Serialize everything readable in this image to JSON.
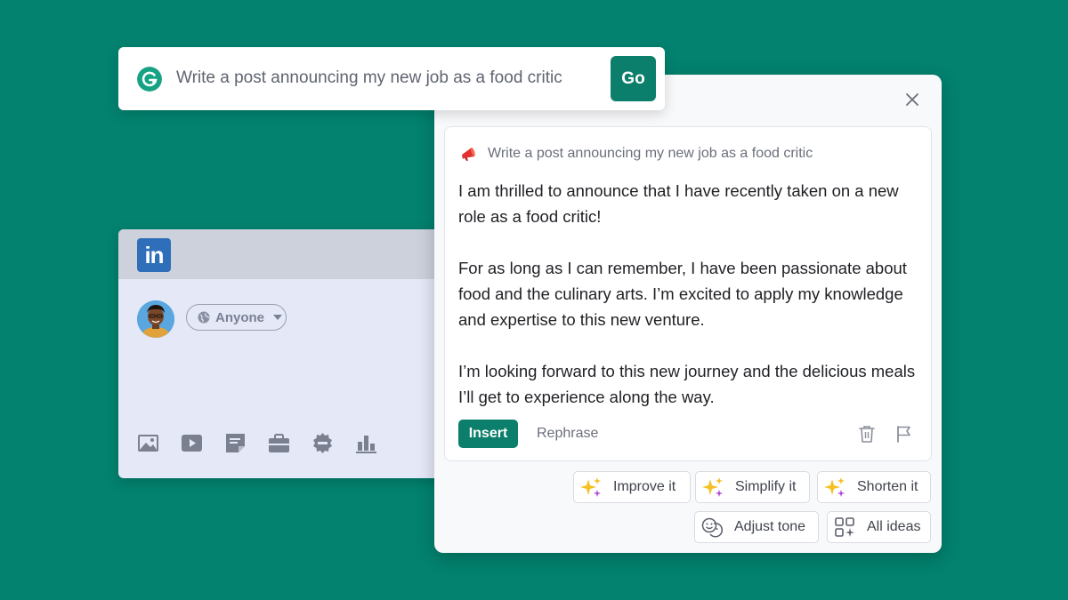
{
  "prompt_bar": {
    "text": "Write a post announcing my new job as a food critic",
    "go_label": "Go"
  },
  "linkedin": {
    "logo": "in",
    "audience": "Anyone",
    "tools": [
      "image-icon",
      "video-icon",
      "document-icon",
      "briefcase-icon",
      "badge-icon",
      "poll-icon"
    ]
  },
  "panel": {
    "prompt_echo": "Write a post announcing my new job as a food critic",
    "paragraphs": [
      "I am thrilled to announce that I have recently taken on a new role as a food critic!",
      "For as long as I can remember, I have been passionate about food and the culinary arts. I’m excited to apply my knowledge and expertise to this new venture.",
      "I’m looking forward to this new journey and the delicious meals I’ll get to experience along the way."
    ],
    "insert_label": "Insert",
    "rephrase_label": "Rephrase",
    "chips": {
      "improve": "Improve it",
      "simplify": "Simplify it",
      "shorten": "Shorten it",
      "adjust_tone": "Adjust tone",
      "all_ideas": "All ideas"
    }
  },
  "colors": {
    "background": "#03826f",
    "accent": "#0b7f6b",
    "linkedin_blue": "#2f6fb9"
  }
}
